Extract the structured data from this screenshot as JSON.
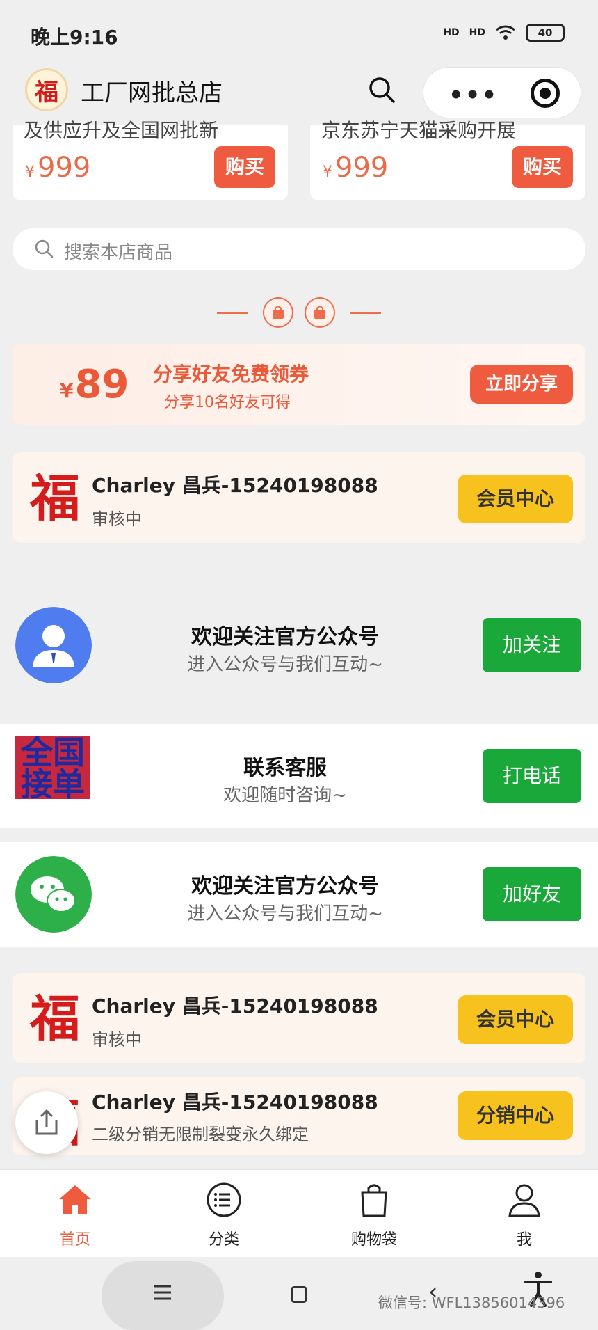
{
  "status_bar": {
    "time": "晚上9:16",
    "net1": "HD",
    "net2": "HD",
    "battery": "40"
  },
  "header": {
    "store_logo": "福",
    "title": "工厂网批总店"
  },
  "products": [
    {
      "cut_text": "及供应升及全国网批新",
      "currency": "¥",
      "price": "999",
      "buy_label": "购买"
    },
    {
      "cut_text": "京东苏宁天猫采购开展",
      "currency": "¥",
      "price": "999",
      "buy_label": "购买"
    }
  ],
  "search": {
    "placeholder": "搜索本店商品"
  },
  "coupon": {
    "currency": "¥",
    "amount": "89",
    "title": "分享好友免费领券",
    "subtitle": "分享10名好友可得",
    "button": "立即分享"
  },
  "member_cards": [
    {
      "logo": "福",
      "name": "Charley 昌兵-15240198088",
      "status": "审核中",
      "button": "会员中心"
    },
    {
      "logo": "福",
      "name": "Charley 昌兵-15240198088",
      "status": "审核中",
      "button": "会员中心"
    },
    {
      "logo": "福",
      "name": "Charley 昌兵-15240198088",
      "status": "二级分销无限制裂变永久绑定",
      "button": "分销中心"
    }
  ],
  "follow_official": {
    "title": "欢迎关注官方公众号",
    "subtitle": "进入公众号与我们互动~",
    "button": "加关注"
  },
  "customer_service": {
    "poster_text": "全国接单",
    "title": "联系客服",
    "subtitle": "欢迎随时咨询~",
    "button": "打电话"
  },
  "follow_wechat": {
    "title": "欢迎关注官方公众号",
    "subtitle": "进入公众号与我们互动~",
    "button": "加好友"
  },
  "tabs": [
    {
      "label": "首页",
      "icon": "home-icon",
      "active": true
    },
    {
      "label": "分类",
      "icon": "list-icon",
      "active": false
    },
    {
      "label": "购物袋",
      "icon": "bag-icon",
      "active": false
    },
    {
      "label": "我",
      "icon": "user-icon",
      "active": false
    }
  ],
  "watermark": "微信号: WFL13856014396",
  "colors": {
    "accent": "#ee5b3f",
    "green": "#1ba83a",
    "yellow": "#f7c21e",
    "blue_avatar": "#4f7df0"
  }
}
